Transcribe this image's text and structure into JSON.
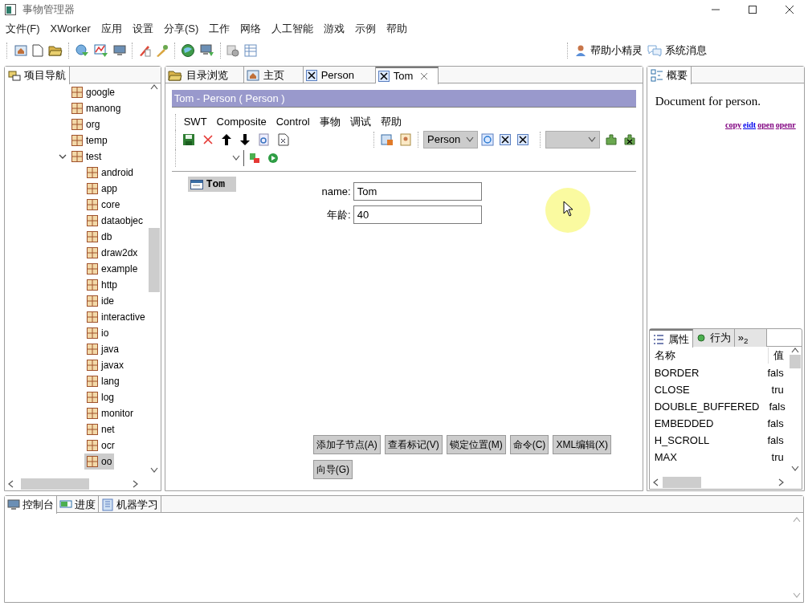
{
  "window": {
    "title": "事物管理器"
  },
  "menu": [
    "文件(F)",
    "XWorker",
    "应用",
    "设置",
    "分享(S)",
    "工作",
    "网络",
    "人工智能",
    "游戏",
    "示例",
    "帮助"
  ],
  "toolbar_links": [
    "帮助小精灵",
    "系统消息"
  ],
  "navigator": {
    "tab": "项目导航",
    "tree": [
      {
        "label": "google",
        "selected": false
      },
      {
        "label": "manong",
        "selected": false
      },
      {
        "label": "org",
        "selected": false
      },
      {
        "label": "temp",
        "selected": false
      },
      {
        "label": "test",
        "selected": false,
        "expanded": true,
        "children": [
          {
            "label": "android",
            "selected": false
          },
          {
            "label": "app",
            "selected": false
          },
          {
            "label": "core",
            "selected": false
          },
          {
            "label": "dataobjec",
            "selected": false
          },
          {
            "label": "db",
            "selected": false
          },
          {
            "label": "draw2dx",
            "selected": false
          },
          {
            "label": "example",
            "selected": false
          },
          {
            "label": "http",
            "selected": false
          },
          {
            "label": "ide",
            "selected": false
          },
          {
            "label": "interactive",
            "selected": false
          },
          {
            "label": "io",
            "selected": false
          },
          {
            "label": "java",
            "selected": false
          },
          {
            "label": "javax",
            "selected": false
          },
          {
            "label": "lang",
            "selected": false
          },
          {
            "label": "log",
            "selected": false
          },
          {
            "label": "monitor",
            "selected": false
          },
          {
            "label": "net",
            "selected": false
          },
          {
            "label": "ocr",
            "selected": false
          },
          {
            "label": "oo",
            "selected": true
          }
        ]
      }
    ]
  },
  "editor": {
    "tabs": [
      {
        "label": "目录浏览",
        "kind": "folder",
        "selected": false
      },
      {
        "label": "主页",
        "kind": "home",
        "selected": false
      },
      {
        "label": "Person",
        "kind": "thing",
        "selected": false
      },
      {
        "label": "Tom",
        "kind": "thing",
        "selected": true
      }
    ],
    "header": "Tom - Person ( Person )",
    "menu": [
      "SWT",
      "Composite",
      "Control",
      "事物",
      "调试",
      "帮助"
    ],
    "type_combo": "Person",
    "chip": "Tom",
    "fields": [
      {
        "label": "name:",
        "value": "Tom"
      },
      {
        "label": "年龄:",
        "value": "40"
      }
    ],
    "buttons": [
      "添加子节点(A)",
      "查看标记(V)",
      "锁定位置(M)",
      "命令(C)",
      "XML编辑(X)",
      "向导(G)"
    ]
  },
  "outline": {
    "tab": "概要",
    "text": "Document for person.",
    "links": [
      {
        "label": "copy",
        "color": "#800080"
      },
      {
        "label": "eidt",
        "color": "#0000ee"
      },
      {
        "label": "open",
        "color": "#800080"
      },
      {
        "label": "openr",
        "color": "#800080"
      }
    ]
  },
  "properties": {
    "tabs": [
      {
        "label": "属性",
        "kind": "list",
        "selected": true
      },
      {
        "label": "行为",
        "kind": "dot",
        "selected": false
      },
      {
        "label": "»$_{2}$",
        "kind": "more",
        "selected": false
      }
    ],
    "columns": [
      "名称",
      "值"
    ],
    "rows": [
      {
        "name": "BORDER",
        "value": "fals"
      },
      {
        "name": "CLOSE",
        "value": "tru"
      },
      {
        "name": "DOUBLE_BUFFERED",
        "value": "fals"
      },
      {
        "name": "EMBEDDED",
        "value": "fals"
      },
      {
        "name": "H_SCROLL",
        "value": "fals"
      },
      {
        "name": "MAX",
        "value": "tru"
      }
    ]
  },
  "console": {
    "tabs": [
      {
        "label": "控制台",
        "kind": "monitor",
        "selected": true
      },
      {
        "label": "进度",
        "kind": "progress",
        "selected": false
      },
      {
        "label": "机器学习",
        "kind": "book",
        "selected": false
      }
    ]
  }
}
